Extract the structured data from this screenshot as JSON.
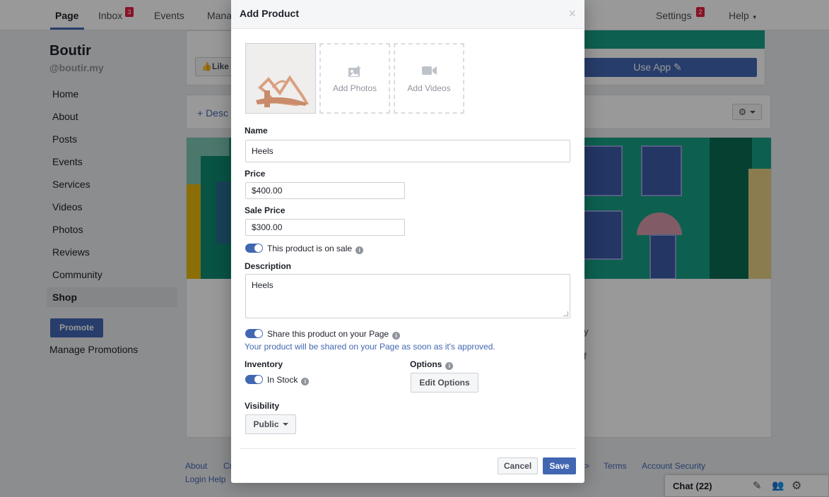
{
  "topnav": {
    "items": [
      {
        "label": "Page"
      },
      {
        "label": "Inbox",
        "badge": "3"
      },
      {
        "label": "Events"
      },
      {
        "label": "Mana"
      },
      {
        "label": "Settings",
        "badge": "2"
      },
      {
        "label": "Help"
      }
    ]
  },
  "page": {
    "name": "Boutir",
    "handle": "@boutir.my",
    "like_label": "Like",
    "use_app_label": "Use App",
    "describe_link": "+ Desc",
    "cover_text_1": "y",
    "cover_text_2": "f"
  },
  "sidebar": {
    "items": [
      {
        "label": "Home"
      },
      {
        "label": "About"
      },
      {
        "label": "Posts"
      },
      {
        "label": "Events"
      },
      {
        "label": "Services"
      },
      {
        "label": "Videos"
      },
      {
        "label": "Photos"
      },
      {
        "label": "Reviews"
      },
      {
        "label": "Community"
      },
      {
        "label": "Shop"
      }
    ],
    "promote_label": "Promote",
    "manage_promotions": "Manage Promotions"
  },
  "footer": {
    "about": "About",
    "cr": "Cr",
    "login_help": "Login Help",
    "arrow": ">",
    "terms": "Terms",
    "account_security": "Account Security"
  },
  "chat": {
    "label": "Chat (22)"
  },
  "modal": {
    "title": "Add Product",
    "close": "×",
    "add_photos": "Add Photos",
    "add_videos": "Add Videos",
    "name_label": "Name",
    "name_value": "Heels",
    "price_label": "Price",
    "price_value": "$400.00",
    "sale_price_label": "Sale Price",
    "sale_price_value": "$300.00",
    "on_sale_label": "This product is on sale",
    "description_label": "Description",
    "description_value": "Heels",
    "share_label": "Share this product on your Page",
    "share_helper": "Your product will be shared on your Page as soon as it's approved.",
    "inventory_label": "Inventory",
    "in_stock_label": "In Stock",
    "options_label": "Options",
    "edit_options_label": "Edit Options",
    "visibility_label": "Visibility",
    "visibility_value": "Public",
    "cancel_label": "Cancel",
    "save_label": "Save"
  },
  "colors": {
    "brand": "#4267b2",
    "badge": "#e41e3f",
    "cover": "#16a086"
  }
}
